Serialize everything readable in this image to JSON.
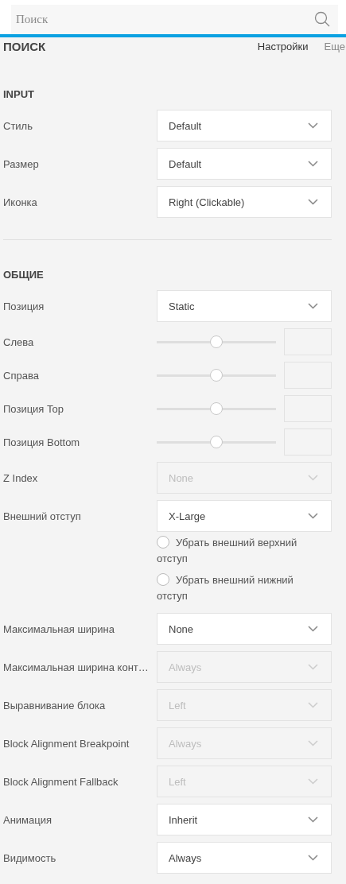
{
  "search": {
    "placeholder": "Поиск"
  },
  "header": {
    "title": "ПОИСК",
    "tabs": [
      {
        "label": "Настройки",
        "selected": true
      },
      {
        "label": "Еще",
        "selected": false
      }
    ]
  },
  "sections": [
    {
      "title": "INPUT",
      "rows": [
        {
          "kind": "select",
          "label": "Стиль",
          "value": "Default",
          "disabled": false
        },
        {
          "kind": "select",
          "label": "Размер",
          "value": "Default",
          "disabled": false
        },
        {
          "kind": "select",
          "label": "Иконка",
          "value": "Right (Clickable)",
          "disabled": false
        }
      ]
    },
    {
      "title": "ОБЩИЕ",
      "rows": [
        {
          "kind": "select",
          "label": "Позиция",
          "value": "Static",
          "disabled": false
        },
        {
          "kind": "slider",
          "label": "Слева",
          "level": 0.5
        },
        {
          "kind": "slider",
          "label": "Справа",
          "level": 0.5
        },
        {
          "kind": "slider",
          "label": "Позиция Top",
          "level": 0.5
        },
        {
          "kind": "slider",
          "label": "Позиция Bottom",
          "level": 0.5
        },
        {
          "kind": "select",
          "label": "Z Index",
          "value": "None",
          "disabled": true
        },
        {
          "kind": "select",
          "label": "Внешний отступ",
          "value": "X-Large",
          "disabled": false
        },
        {
          "kind": "checkbox",
          "label": "Убрать внешний верхний отступ",
          "checked": false
        },
        {
          "kind": "checkbox",
          "label": "Убрать внешний нижний отступ",
          "checked": false
        },
        {
          "kind": "select",
          "label": "Максимальная ширина",
          "value": "None",
          "disabled": false
        },
        {
          "kind": "select",
          "label": "Максимальная ширина конт…",
          "value": "Always",
          "disabled": true
        },
        {
          "kind": "select",
          "label": "Выравнивание блока",
          "value": "Left",
          "disabled": true
        },
        {
          "kind": "select",
          "label": "Block Alignment Breakpoint",
          "value": "Always",
          "disabled": true
        },
        {
          "kind": "select",
          "label": "Block Alignment Fallback",
          "value": "Left",
          "disabled": true
        },
        {
          "kind": "select",
          "label": "Анимация",
          "value": "Inherit",
          "disabled": false
        },
        {
          "kind": "select",
          "label": "Видимость",
          "value": "Always",
          "disabled": false
        }
      ]
    }
  ]
}
